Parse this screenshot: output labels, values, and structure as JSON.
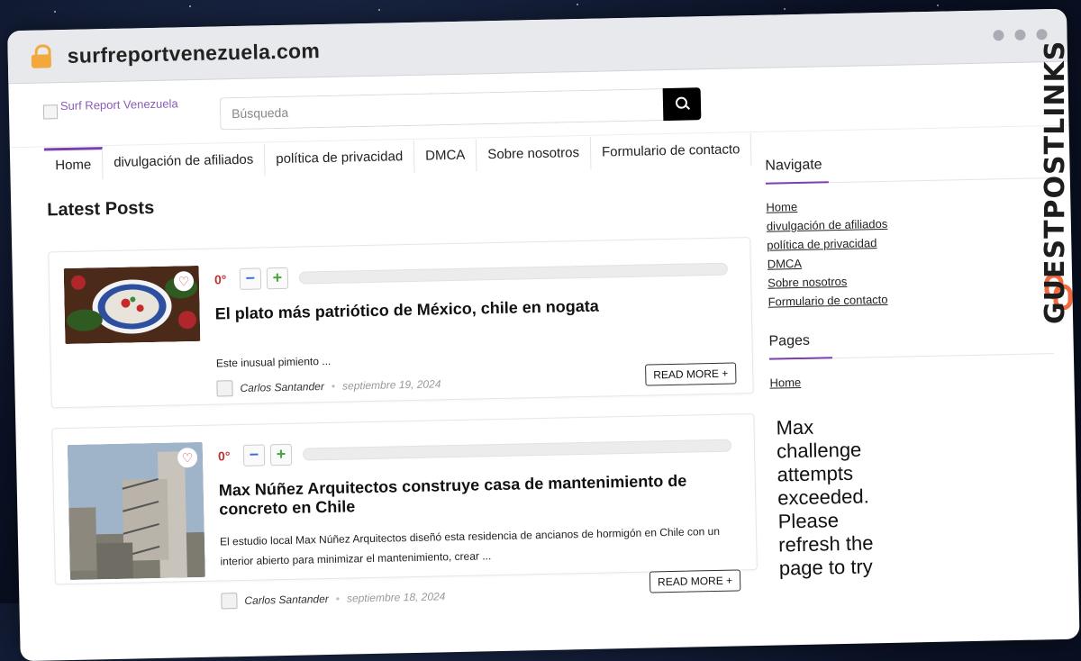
{
  "browser": {
    "url": "surfreportvenezuela.com"
  },
  "header": {
    "logo_alt": "Surf Report Venezuela",
    "search_placeholder": "Búsqueda"
  },
  "nav": {
    "items": [
      {
        "label": "Home"
      },
      {
        "label": "divulgación de afiliados"
      },
      {
        "label": "política de privacidad"
      },
      {
        "label": "DMCA"
      },
      {
        "label": "Sobre nosotros"
      },
      {
        "label": "Formulario de contacto"
      }
    ]
  },
  "main": {
    "heading": "Latest Posts",
    "posts": [
      {
        "votes": "0°",
        "title": "El plato más patriótico de México, chile en nogata",
        "excerpt": "Este inusual pimiento ...",
        "author": "Carlos Santander",
        "date": "septiembre 19, 2024",
        "read_more": "READ MORE +"
      },
      {
        "votes": "0°",
        "title": "Max Núñez Arquitectos construye casa de mantenimiento de concreto en Chile",
        "excerpt": "El estudio local Max Núñez Arquitectos diseñó esta residencia de ancianos de hormigón en Chile con un interior abierto para minimizar el mantenimiento, crear ...",
        "author": "Carlos Santander",
        "date": "septiembre 18, 2024",
        "read_more": "READ MORE +"
      }
    ]
  },
  "sidebar": {
    "navigate": {
      "title": "Navigate",
      "links": [
        "Home",
        "divulgación de afiliados",
        "política de privacidad",
        "DMCA",
        "Sobre nosotros",
        "Formulario de contacto"
      ]
    },
    "pages": {
      "title": "Pages",
      "links": [
        "Home"
      ]
    },
    "challenge_text": "Max challenge attempts exceeded. Please refresh the page to try"
  },
  "watermark": {
    "text": "GUESTPOSTLINKS"
  },
  "colors": {
    "accent": "#7b3fb0",
    "search_button": "#000000",
    "vote_degree": "#c23131",
    "watermark_icon": "#f26a3d"
  }
}
